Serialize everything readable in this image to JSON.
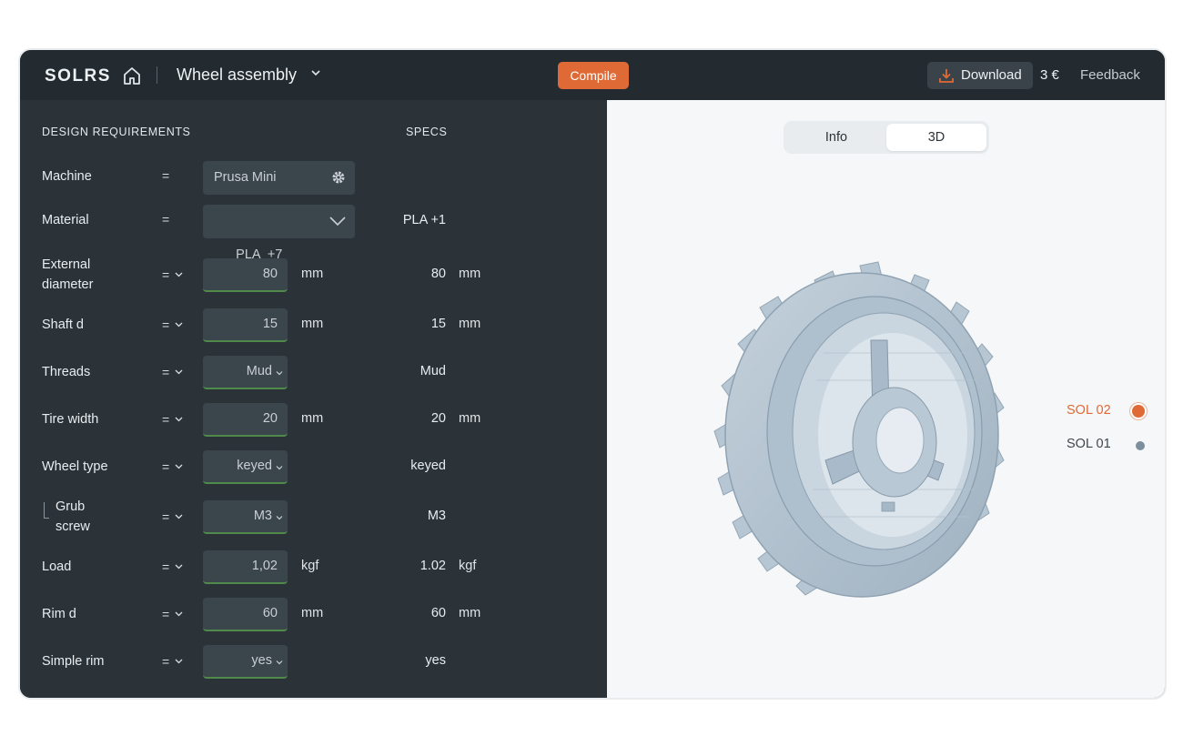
{
  "header": {
    "project_title": "Wheel assembly",
    "compile_label": "Compile",
    "download_label": "Download",
    "price": "3 €",
    "feedback_label": "Feedback",
    "logo_text": "SOLRS"
  },
  "requirements": {
    "heading": "DESIGN REQUIREMENTS",
    "specs_heading": "SPECS",
    "rows": [
      {
        "label": "Machine",
        "eq": "=",
        "value": "Prusa Mini",
        "spec": ""
      },
      {
        "label": "Material",
        "eq": "=",
        "value": "PLA  +7",
        "spec": "PLA +1"
      },
      {
        "label": "External diameter",
        "eq": "=",
        "value": "80",
        "unit": "mm",
        "spec": "80",
        "spec_unit": "mm"
      },
      {
        "label": "Shaft d",
        "eq": "=",
        "value": "15",
        "unit": "mm",
        "spec": "15",
        "spec_unit": "mm"
      },
      {
        "label": "Threads",
        "eq": "=",
        "value": "Mud",
        "spec": "Mud"
      },
      {
        "label": "Tire width",
        "eq": "=",
        "value": "20",
        "unit": "mm",
        "spec": "20",
        "spec_unit": "mm"
      },
      {
        "label": "Wheel type",
        "eq": "=",
        "value": "keyed",
        "spec": "keyed"
      },
      {
        "label": "Grub screw",
        "eq": "=",
        "value": "M3",
        "spec": "M3"
      },
      {
        "label": "Load",
        "eq": "=",
        "value": "1,02",
        "unit": "kgf",
        "spec": "1.02",
        "spec_unit": "kgf"
      },
      {
        "label": "Rim d",
        "eq": "=",
        "value": "60",
        "unit": "mm",
        "spec": "60",
        "spec_unit": "mm"
      },
      {
        "label": "Simple rim",
        "eq": "=",
        "value": "yes",
        "spec": "yes"
      }
    ]
  },
  "viewer": {
    "tabs": [
      "Info",
      "3D"
    ],
    "active_tab": "3D",
    "solutions": [
      {
        "label": "SOL 02",
        "color": "#e06a36",
        "selected": true
      },
      {
        "label": "SOL 01",
        "color": "#7d8e9c",
        "selected": false
      }
    ]
  },
  "colors": {
    "accent": "#e06a36",
    "field_ok": "#4f8a4a",
    "panel": "#2b3339",
    "topbar": "#232b31"
  }
}
